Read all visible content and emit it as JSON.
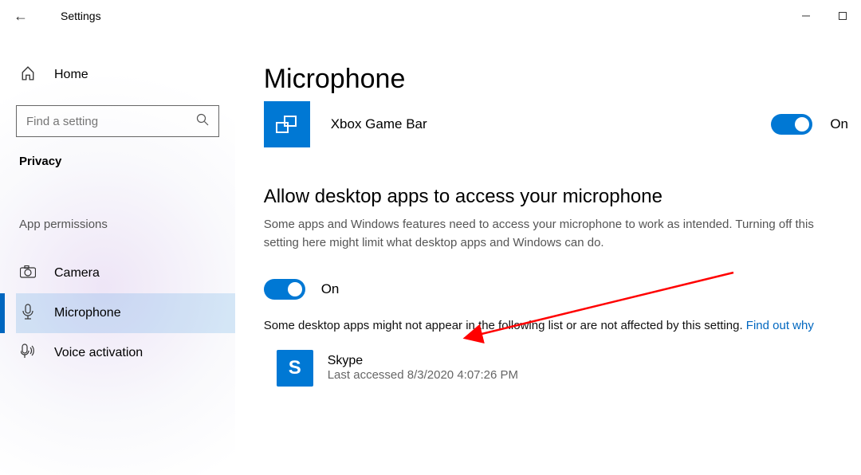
{
  "window": {
    "title": "Settings",
    "back_tooltip": "Back"
  },
  "sidebar": {
    "home_label": "Home",
    "search_placeholder": "Find a setting",
    "current_section": "Privacy",
    "section_header": "App permissions",
    "items": [
      {
        "icon": "camera-icon",
        "label": "Camera",
        "active": false
      },
      {
        "icon": "microphone-icon",
        "label": "Microphone",
        "active": true
      },
      {
        "icon": "voice-icon",
        "label": "Voice activation",
        "active": false
      }
    ]
  },
  "main": {
    "page_title": "Microphone",
    "store_app": {
      "name": "Xbox Game Bar",
      "toggle_state": "On"
    },
    "allow_section": {
      "heading": "Allow desktop apps to access your microphone",
      "description": "Some apps and Windows features need to access your microphone to work as intended. Turning off this setting here might limit what desktop apps and Windows can do.",
      "toggle_state": "On",
      "note_text_before": "Some desktop apps might not appear in the following list or are not affected by this setting. ",
      "note_link": "Find out why"
    },
    "desktop_app": {
      "name": "Skype",
      "subtext": "Last accessed 8/3/2020 4:07:26 PM"
    }
  }
}
